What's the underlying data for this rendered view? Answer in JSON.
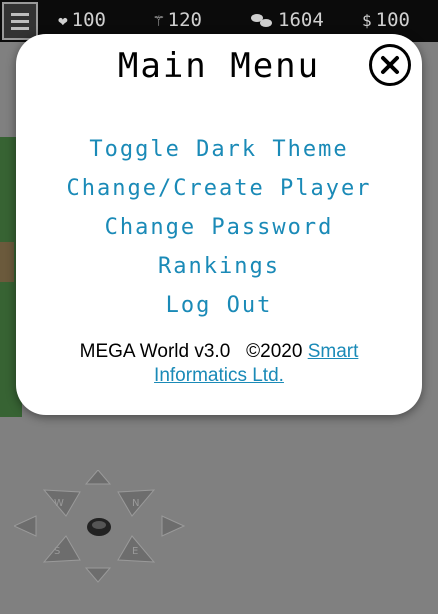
{
  "topbar": {
    "menu_icon": "hamburger-icon",
    "stats": [
      {
        "icon": "heart-icon",
        "glyph": "❤",
        "value": "100"
      },
      {
        "icon": "magic-wand-icon",
        "glyph": "⚚",
        "value": "120"
      },
      {
        "icon": "footsteps-icon",
        "glyph": "👣",
        "value": "1604"
      },
      {
        "icon": "dollar-icon",
        "glyph": "$",
        "value": "100"
      }
    ]
  },
  "modal": {
    "title": "Main Menu",
    "close_icon": "close-icon",
    "items": [
      {
        "label": "Toggle Dark Theme"
      },
      {
        "label": "Change/Create Player"
      },
      {
        "label": "Change Password"
      },
      {
        "label": "Rankings"
      },
      {
        "label": "Log Out"
      }
    ],
    "footer": {
      "version": "MEGA World v3.0",
      "copyright": "©2020",
      "company_link": "Smart Informatics Ltd."
    }
  },
  "compass": {
    "labels": [
      "N",
      "E",
      "S",
      "W"
    ]
  },
  "colors": {
    "accent": "#1a8ab7",
    "topbar": "#0b0b0b",
    "overlay": "#7d7d7d"
  }
}
